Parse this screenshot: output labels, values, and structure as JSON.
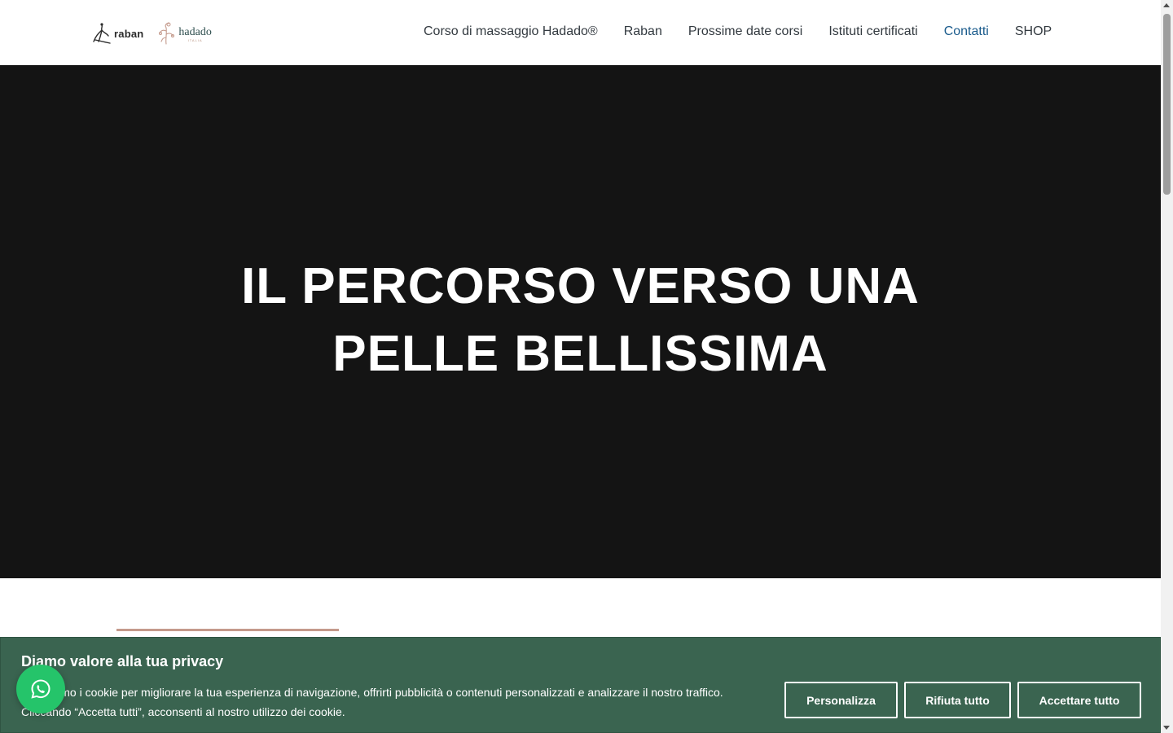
{
  "header": {
    "logos": {
      "raban": {
        "text": "raban"
      },
      "hadado": {
        "text": "hadado",
        "sub": "ITALIA"
      }
    },
    "nav": [
      {
        "label": "Corso di massaggio Hadado®",
        "active": false
      },
      {
        "label": "Raban",
        "active": false
      },
      {
        "label": "Prossime date corsi",
        "active": false
      },
      {
        "label": "Istituti certificati",
        "active": false
      },
      {
        "label": "Contatti",
        "active": true
      },
      {
        "label": "SHOP",
        "active": false
      }
    ]
  },
  "hero": {
    "title_line1": "IL PERCORSO VERSO UNA",
    "title_line2": "PELLE BELLISSIMA"
  },
  "cookie_banner": {
    "title": "Diamo valore alla tua privacy",
    "text_line1": "Utilizziamo i cookie per migliorare la tua esperienza di navigazione, offrirti pubblicità o contenuti personalizzati e analizzare il nostro traffico.",
    "text_line2": "Cliccando “Accetta tutti”, acconsenti al nostro utilizzo dei cookie.",
    "buttons": {
      "customize": "Personalizza",
      "reject": "Rifiuta tutto",
      "accept": "Accettare tutto"
    }
  },
  "floating": {
    "whatsapp_icon": "whatsapp-icon"
  },
  "colors": {
    "hero_bg": "#141414",
    "cookie_bg": "#3a6450",
    "nav_active": "#1a5b8c",
    "accent": "#c49a8c",
    "whatsapp": "#25c46a"
  }
}
